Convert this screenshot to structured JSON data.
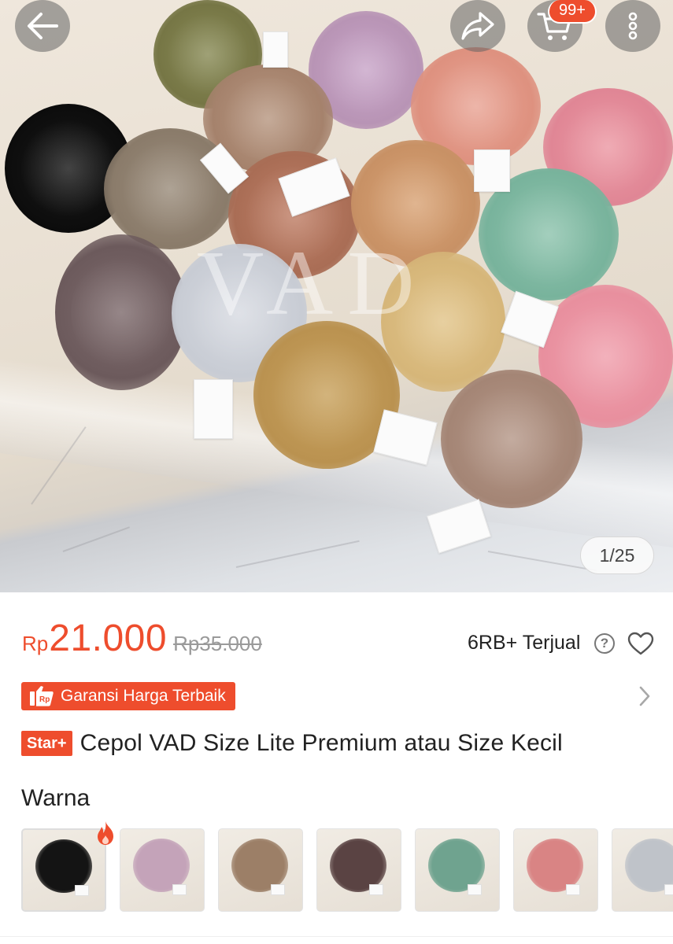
{
  "header": {
    "back_icon": "arrow-left-icon",
    "share_icon": "share-icon",
    "cart_icon": "cart-icon",
    "cart_badge": "99+",
    "more_icon": "more-vertical-icon"
  },
  "gallery": {
    "watermark": "VAD",
    "counter": "1/25"
  },
  "product": {
    "price_currency": "Rp",
    "price": "21.000",
    "original_price": "Rp35.000",
    "sold": "6RB+ Terjual",
    "guarantee_label": "Garansi Harga Terbaik",
    "badge": "Star+",
    "title": "Cepol VAD Size Lite Premium atau Size Kecil"
  },
  "variants": {
    "label": "Warna",
    "swatch_colors": [
      "#141414",
      "#c4a3b9",
      "#9c7f67",
      "#5a4343",
      "#6fa38f",
      "#d98484",
      "#bfc3c9"
    ]
  },
  "colors": {
    "accent": "#ee4d2d"
  }
}
